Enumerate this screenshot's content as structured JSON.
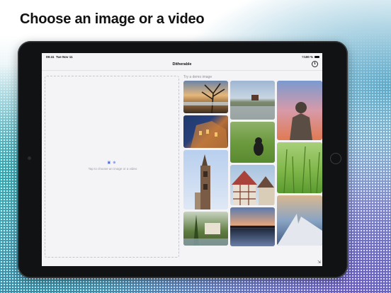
{
  "marketing": {
    "headline": "Choose an image or a video"
  },
  "status_bar": {
    "time": "09:41",
    "date": "Tue Nov 11",
    "battery": "100 %"
  },
  "nav": {
    "title": "Ditherable",
    "info_icon": "info-icon"
  },
  "drop_zone": {
    "hint": "Tap to choose an image or a video",
    "icons": [
      "photo-icon",
      "plus-icon"
    ]
  },
  "demo": {
    "label": "Try a demo image",
    "images": [
      "river-tree-sunset",
      "castle-night",
      "church-tower",
      "park-house",
      "hill-building",
      "green-field",
      "half-timbered-houses",
      "sunset-lake",
      "statue-sky",
      "tall-grass",
      "mountain-peak"
    ]
  },
  "colors": {
    "accent": "#4a67d6",
    "screen_bg": "#f4f4f7"
  }
}
